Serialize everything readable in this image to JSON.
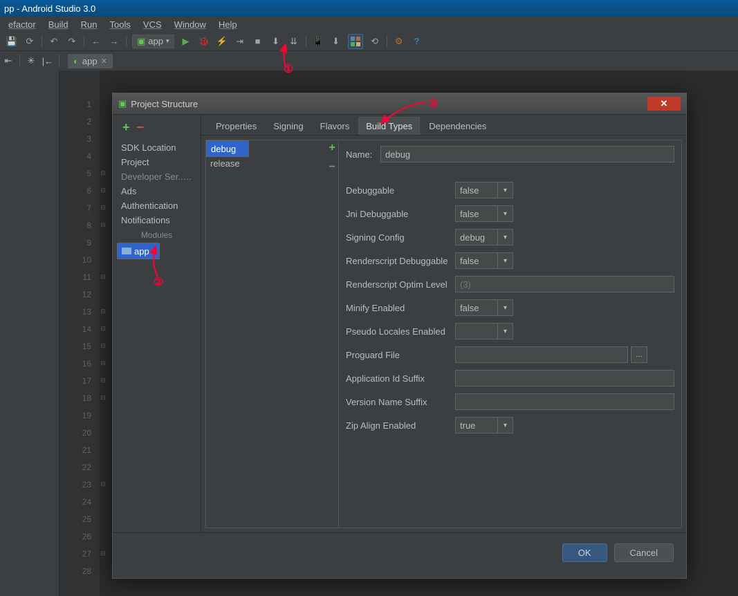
{
  "window_title": "pp - Android Studio 3.0",
  "menu": {
    "refactor": "efactor",
    "build": "Build",
    "run": "Run",
    "tools": "Tools",
    "vcs": "VCS",
    "window": "Window",
    "help": "Help"
  },
  "toolbar": {
    "config_label": "app"
  },
  "editor_tab": {
    "name": "app"
  },
  "gutter_lines": 28,
  "dialog": {
    "title": "Project Structure",
    "left_items": [
      "SDK Location",
      "Project",
      "Developer Ser... ...",
      "Ads",
      "Authentication",
      "Notifications"
    ],
    "modules_header": "Modules",
    "module_name": "app",
    "tabs": [
      "Properties",
      "Signing",
      "Flavors",
      "Build Types",
      "Dependencies"
    ],
    "active_tab": "Build Types",
    "variants": [
      "debug",
      "release"
    ],
    "selected_variant": "debug",
    "form": {
      "name_label": "Name:",
      "name_value": "debug",
      "debuggable_label": "Debuggable",
      "debuggable_value": "false",
      "jni_label": "Jni Debuggable",
      "jni_value": "false",
      "signing_label": "Signing Config",
      "signing_value": "debug",
      "rs_dbg_label": "Renderscript Debuggable",
      "rs_dbg_value": "false",
      "rs_opt_label": "Renderscript Optim Level",
      "rs_opt_placeholder": "(3)",
      "minify_label": "Minify Enabled",
      "minify_value": "false",
      "pseudo_label": "Pseudo Locales Enabled",
      "pseudo_value": "",
      "proguard_label": "Proguard File",
      "appid_label": "Application Id Suffix",
      "version_label": "Version Name Suffix",
      "zip_label": "Zip Align Enabled",
      "zip_value": "true"
    },
    "ok": "OK",
    "cancel": "Cancel"
  },
  "annot": {
    "one": "①",
    "two": "②",
    "three": "③"
  }
}
